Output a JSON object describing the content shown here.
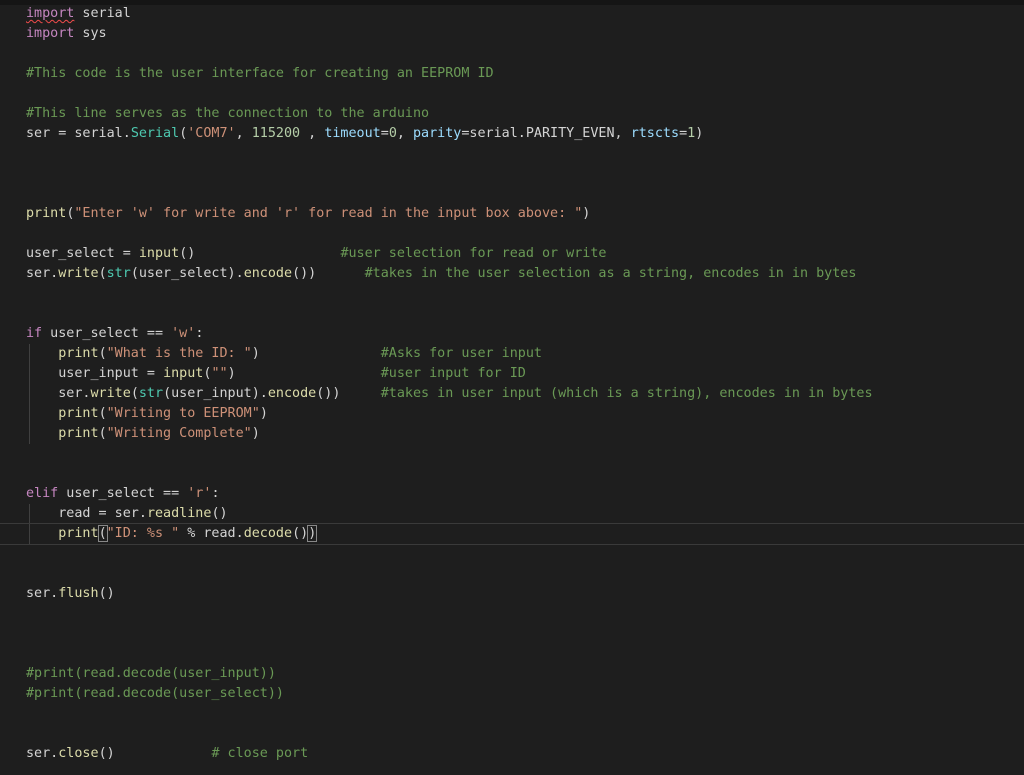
{
  "editor": {
    "language": "python",
    "theme_background": "#1e1e1e",
    "lines": [
      {
        "n": 1,
        "tokens": [
          [
            "kw",
            "import"
          ],
          [
            "op",
            " serial"
          ]
        ]
      },
      {
        "n": 2,
        "tokens": [
          [
            "kw",
            "import"
          ],
          [
            "op",
            " sys"
          ]
        ]
      },
      {
        "n": 3,
        "tokens": []
      },
      {
        "n": 4,
        "tokens": [
          [
            "cm",
            "#This code is the user interface for creating an EEPROM ID"
          ]
        ]
      },
      {
        "n": 5,
        "tokens": []
      },
      {
        "n": 6,
        "tokens": [
          [
            "cm",
            "#This line serves as the connection to the arduino"
          ]
        ]
      },
      {
        "n": 7,
        "tokens": [
          [
            "op",
            "ser = serial."
          ],
          [
            "bi",
            "Serial"
          ],
          [
            "op",
            "("
          ],
          [
            "str",
            "'COM7'"
          ],
          [
            "op",
            ", "
          ],
          [
            "num",
            "115200"
          ],
          [
            "op",
            " , "
          ],
          [
            "var",
            "timeout"
          ],
          [
            "op",
            "="
          ],
          [
            "num",
            "0"
          ],
          [
            "op",
            ", "
          ],
          [
            "var",
            "parity"
          ],
          [
            "op",
            "=serial.PARITY_EVEN, "
          ],
          [
            "var",
            "rtscts"
          ],
          [
            "op",
            "="
          ],
          [
            "num",
            "1"
          ],
          [
            "op",
            ")"
          ]
        ]
      },
      {
        "n": 8,
        "tokens": []
      },
      {
        "n": 9,
        "tokens": []
      },
      {
        "n": 10,
        "tokens": []
      },
      {
        "n": 11,
        "tokens": [
          [
            "fn",
            "print"
          ],
          [
            "op",
            "("
          ],
          [
            "str",
            "\"Enter 'w' for write and 'r' for read in the input box above: \""
          ],
          [
            "op",
            ")"
          ]
        ]
      },
      {
        "n": 12,
        "tokens": []
      },
      {
        "n": 13,
        "tokens": [
          [
            "op",
            "user_select = "
          ],
          [
            "fn",
            "input"
          ],
          [
            "op",
            "()                  "
          ],
          [
            "cm",
            "#user selection for read or write"
          ]
        ]
      },
      {
        "n": 14,
        "tokens": [
          [
            "op",
            "ser."
          ],
          [
            "fn",
            "write"
          ],
          [
            "op",
            "("
          ],
          [
            "bi",
            "str"
          ],
          [
            "op",
            "(user_select)."
          ],
          [
            "fn",
            "encode"
          ],
          [
            "op",
            "())      "
          ],
          [
            "cm",
            "#takes in the user selection as a string, encodes in in bytes"
          ]
        ]
      },
      {
        "n": 15,
        "tokens": []
      },
      {
        "n": 16,
        "tokens": []
      },
      {
        "n": 17,
        "tokens": [
          [
            "kw",
            "if"
          ],
          [
            "op",
            " user_select == "
          ],
          [
            "str",
            "'w'"
          ],
          [
            "op",
            ":"
          ]
        ]
      },
      {
        "n": 18,
        "indent": true,
        "tokens": [
          [
            "fn",
            "print"
          ],
          [
            "op",
            "("
          ],
          [
            "str",
            "\"What is the ID: \""
          ],
          [
            "op",
            ")               "
          ],
          [
            "cm",
            "#Asks for user input"
          ]
        ]
      },
      {
        "n": 19,
        "indent": true,
        "tokens": [
          [
            "op",
            "user_input = "
          ],
          [
            "fn",
            "input"
          ],
          [
            "op",
            "("
          ],
          [
            "str",
            "\"\""
          ],
          [
            "op",
            ")                  "
          ],
          [
            "cm",
            "#user input for ID"
          ]
        ]
      },
      {
        "n": 20,
        "indent": true,
        "tokens": [
          [
            "op",
            "ser."
          ],
          [
            "fn",
            "write"
          ],
          [
            "op",
            "("
          ],
          [
            "bi",
            "str"
          ],
          [
            "op",
            "(user_input)."
          ],
          [
            "fn",
            "encode"
          ],
          [
            "op",
            "())     "
          ],
          [
            "cm",
            "#takes in user input (which is a string), encodes in in bytes"
          ]
        ]
      },
      {
        "n": 21,
        "indent": true,
        "tokens": [
          [
            "fn",
            "print"
          ],
          [
            "op",
            "("
          ],
          [
            "str",
            "\"Writing to EEPROM\""
          ],
          [
            "op",
            ")"
          ]
        ]
      },
      {
        "n": 22,
        "indent": true,
        "tokens": [
          [
            "fn",
            "print"
          ],
          [
            "op",
            "("
          ],
          [
            "str",
            "\"Writing Complete\""
          ],
          [
            "op",
            ")"
          ]
        ]
      },
      {
        "n": 23,
        "tokens": []
      },
      {
        "n": 24,
        "tokens": []
      },
      {
        "n": 25,
        "tokens": [
          [
            "kw",
            "elif"
          ],
          [
            "op",
            " user_select == "
          ],
          [
            "str",
            "'r'"
          ],
          [
            "op",
            ":"
          ]
        ]
      },
      {
        "n": 26,
        "indent": true,
        "tokens": [
          [
            "op",
            "read = ser."
          ],
          [
            "fn",
            "readline"
          ],
          [
            "op",
            "()"
          ]
        ]
      },
      {
        "n": 27,
        "indent": true,
        "active": true,
        "tokens": [
          [
            "fn",
            "print"
          ],
          [
            "op",
            "("
          ],
          [
            "str",
            "\"ID: %s \""
          ],
          [
            "op",
            " % read."
          ],
          [
            "fn",
            "decode"
          ],
          [
            "op",
            "()"
          ],
          [
            "op",
            ")"
          ]
        ]
      },
      {
        "n": 28,
        "tokens": []
      },
      {
        "n": 29,
        "tokens": []
      },
      {
        "n": 30,
        "tokens": [
          [
            "op",
            "ser."
          ],
          [
            "fn",
            "flush"
          ],
          [
            "op",
            "()"
          ]
        ]
      },
      {
        "n": 31,
        "tokens": []
      },
      {
        "n": 32,
        "tokens": []
      },
      {
        "n": 33,
        "tokens": []
      },
      {
        "n": 34,
        "tokens": [
          [
            "cm",
            "#print(read.decode(user_input))"
          ]
        ]
      },
      {
        "n": 35,
        "tokens": [
          [
            "cm",
            "#print(read.decode(user_select))"
          ]
        ]
      },
      {
        "n": 36,
        "tokens": []
      },
      {
        "n": 37,
        "tokens": []
      },
      {
        "n": 38,
        "tokens": [
          [
            "op",
            "ser."
          ],
          [
            "fn",
            "close"
          ],
          [
            "op",
            "()            "
          ],
          [
            "cm",
            "# close port"
          ]
        ]
      }
    ]
  }
}
